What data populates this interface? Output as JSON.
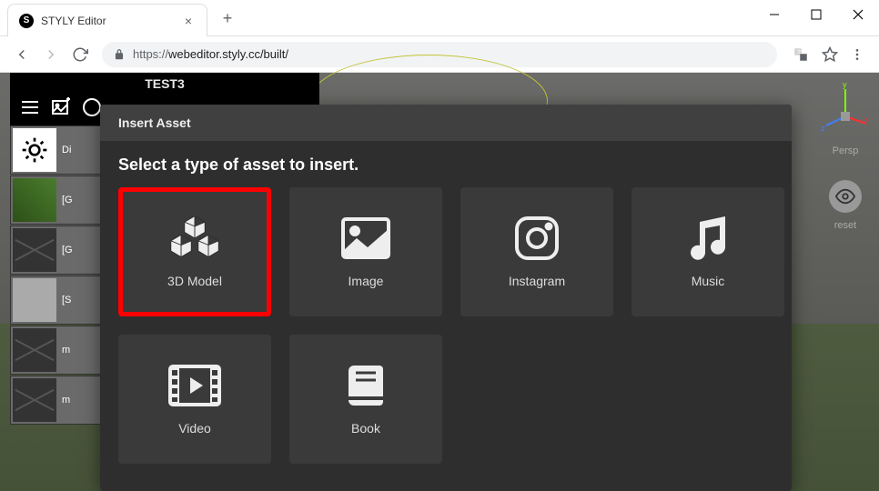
{
  "browser": {
    "tab_title": "STYLY Editor",
    "url_protocol": "https://",
    "url_rest": "webeditor.styly.cc/built/"
  },
  "editor": {
    "scene_title": "TEST3",
    "hierarchy": [
      {
        "label": "Di",
        "thumb": "light"
      },
      {
        "label": "[G",
        "thumb": "grass"
      },
      {
        "label": "[G",
        "thumb": "cross"
      },
      {
        "label": "[S",
        "thumb": "blank"
      },
      {
        "label": "m",
        "thumb": "cross"
      },
      {
        "label": "m",
        "thumb": "cross"
      }
    ],
    "gizmo_label": "Persp",
    "reset_label": "reset"
  },
  "modal": {
    "title": "Insert Asset",
    "subtitle": "Select a type of asset to insert.",
    "assets": [
      {
        "label": "3D Model",
        "icon": "cubes",
        "highlight": true
      },
      {
        "label": "Image",
        "icon": "image",
        "highlight": false
      },
      {
        "label": "Instagram",
        "icon": "instagram",
        "highlight": false
      },
      {
        "label": "Music",
        "icon": "music",
        "highlight": false
      },
      {
        "label": "Video",
        "icon": "video",
        "highlight": false
      },
      {
        "label": "Book",
        "icon": "book",
        "highlight": false
      }
    ]
  }
}
